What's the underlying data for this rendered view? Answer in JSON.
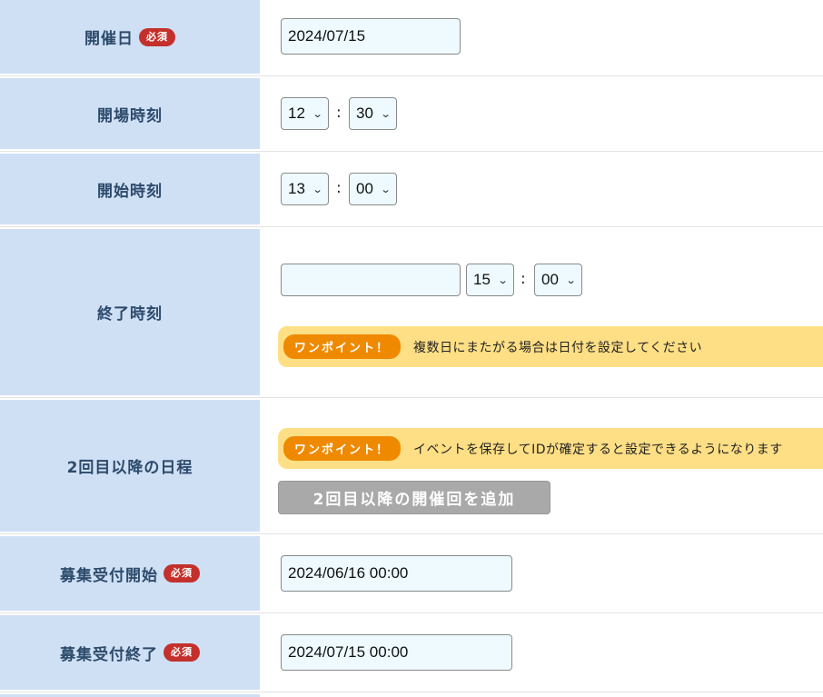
{
  "required_badge": "必須",
  "colon": ":",
  "rows": {
    "date": {
      "label": "開催日",
      "value": "2024/07/15"
    },
    "open_time": {
      "label": "開場時刻",
      "hour": "12",
      "minute": "30"
    },
    "start_time": {
      "label": "開始時刻",
      "hour": "13",
      "minute": "00"
    },
    "end_time": {
      "label": "終了時刻",
      "date_value": "",
      "hour": "15",
      "minute": "00",
      "tip_badge": "ワンポイント！",
      "tip_text": "複数日にまたがる場合は日付を設定してください"
    },
    "schedule": {
      "label": "2回目以降の日程",
      "tip_badge": "ワンポイント！",
      "tip_text": "イベントを保存してIDが確定すると設定できるようになります",
      "add_button": "2回目以降の開催回を追加"
    },
    "recruit_start": {
      "label": "募集受付開始",
      "value": "2024/06/16 00:00"
    },
    "recruit_end": {
      "label": "募集受付終了",
      "value": "2024/07/15 00:00"
    }
  }
}
